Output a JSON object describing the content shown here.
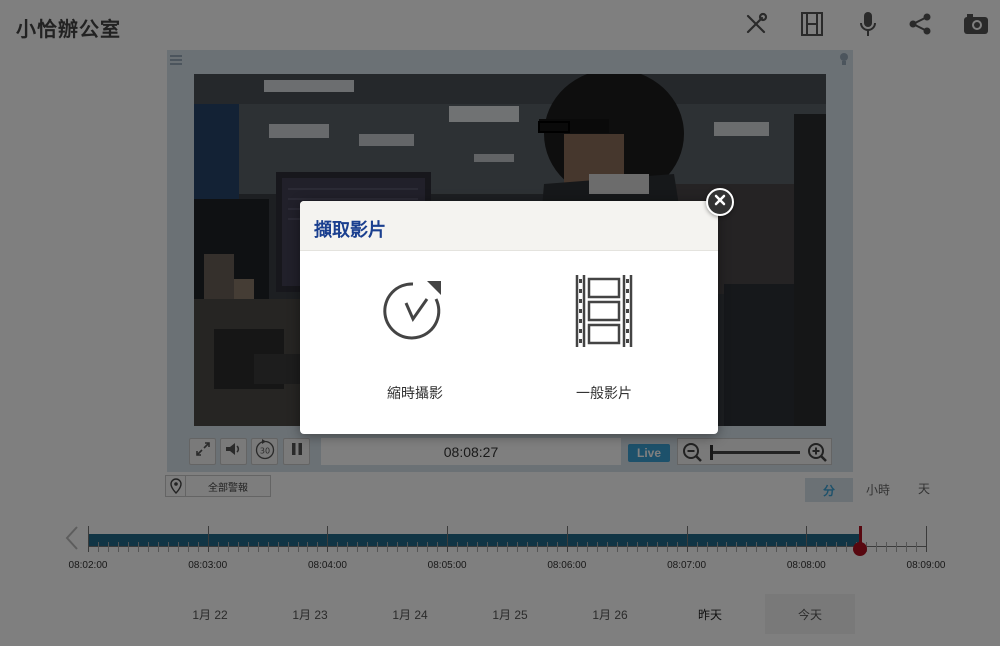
{
  "header": {
    "title": "小恰辦公室",
    "icons": [
      "tools-icon",
      "film-icon",
      "microphone-icon",
      "share-icon",
      "camera-icon"
    ]
  },
  "player": {
    "timestamp": "08:08:27",
    "live_label": "Live",
    "controls": [
      "fullscreen-icon",
      "volume-icon",
      "replay-30-icon",
      "pause-icon"
    ],
    "zoom_level": 0.0
  },
  "alarm": {
    "label": "全部警報"
  },
  "scale": {
    "minute": "分",
    "hour": "小時",
    "day": "天"
  },
  "timeline": {
    "labels": [
      "08:02:00",
      "08:03:00",
      "08:04:00",
      "08:05:00",
      "08:06:00",
      "08:07:00",
      "08:08:00",
      "08:09:00"
    ],
    "recorded_until": "08:08:27"
  },
  "days": [
    "1月 22",
    "1月 23",
    "1月 24",
    "1月 25",
    "1月 26",
    "昨天",
    "今天"
  ],
  "modal": {
    "title": "擷取影片",
    "options": [
      {
        "label": "縮時攝影",
        "icon": "timelapse-icon"
      },
      {
        "label": "一般影片",
        "icon": "film-strip-icon"
      }
    ]
  },
  "colors": {
    "accent": "#3ba3d6",
    "title_blue": "#1a3f8f",
    "timeline_bar": "#236a8a",
    "needle": "#b01020"
  }
}
